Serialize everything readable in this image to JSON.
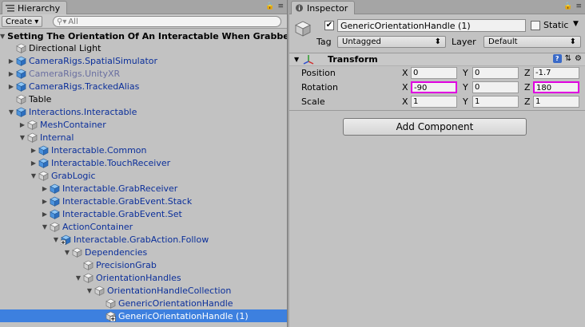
{
  "hierarchy": {
    "tab_label": "Hierarchy",
    "create_label": "Create",
    "search_placeholder": "All",
    "scene_title": "Setting The Orientation Of An Interactable When Grabbed",
    "items": [
      {
        "label": "Directional Light",
        "depth": 1,
        "arrow": "",
        "style": "normal",
        "icon": "cube-gray"
      },
      {
        "label": "CameraRigs.SpatialSimulator",
        "depth": 1,
        "arrow": "collapsed",
        "style": "blue",
        "icon": "prefab-cube"
      },
      {
        "label": "CameraRigs.UnityXR",
        "depth": 1,
        "arrow": "collapsed",
        "style": "dim",
        "icon": "prefab-cube"
      },
      {
        "label": "CameraRigs.TrackedAlias",
        "depth": 1,
        "arrow": "collapsed",
        "style": "blue",
        "icon": "prefab-cube"
      },
      {
        "label": "Table",
        "depth": 1,
        "arrow": "",
        "style": "normal",
        "icon": "cube-gray"
      },
      {
        "label": "Interactions.Interactable",
        "depth": 1,
        "arrow": "expanded",
        "style": "blue",
        "icon": "prefab-cube"
      },
      {
        "label": "MeshContainer",
        "depth": 2,
        "arrow": "collapsed",
        "style": "blue",
        "icon": "cube-gray"
      },
      {
        "label": "Internal",
        "depth": 2,
        "arrow": "expanded",
        "style": "blue",
        "icon": "cube-gray"
      },
      {
        "label": "Interactable.Common",
        "depth": 3,
        "arrow": "collapsed",
        "style": "blue",
        "icon": "prefab-cube"
      },
      {
        "label": "Interactable.TouchReceiver",
        "depth": 3,
        "arrow": "collapsed",
        "style": "blue",
        "icon": "prefab-cube"
      },
      {
        "label": "GrabLogic",
        "depth": 3,
        "arrow": "expanded",
        "style": "blue",
        "icon": "cube-gray"
      },
      {
        "label": "Interactable.GrabReceiver",
        "depth": 4,
        "arrow": "collapsed",
        "style": "blue",
        "icon": "prefab-cube"
      },
      {
        "label": "Interactable.GrabEvent.Stack",
        "depth": 4,
        "arrow": "collapsed",
        "style": "blue",
        "icon": "prefab-cube"
      },
      {
        "label": "Interactable.GrabEvent.Set",
        "depth": 4,
        "arrow": "collapsed",
        "style": "blue",
        "icon": "prefab-cube"
      },
      {
        "label": "ActionContainer",
        "depth": 4,
        "arrow": "expanded",
        "style": "blue",
        "icon": "cube-gray"
      },
      {
        "label": "Interactable.GrabAction.Follow",
        "depth": 5,
        "arrow": "expanded",
        "style": "blue",
        "icon": "prefab-add-cube"
      },
      {
        "label": "Dependencies",
        "depth": 6,
        "arrow": "expanded",
        "style": "blue",
        "icon": "cube-gray"
      },
      {
        "label": "PrecisionGrab",
        "depth": 7,
        "arrow": "",
        "style": "blue",
        "icon": "cube-gray"
      },
      {
        "label": "OrientationHandles",
        "depth": 7,
        "arrow": "expanded",
        "style": "blue",
        "icon": "cube-gray"
      },
      {
        "label": "OrientationHandleCollection",
        "depth": 8,
        "arrow": "expanded",
        "style": "blue",
        "icon": "cube-gray"
      },
      {
        "label": "GenericOrientationHandle",
        "depth": 9,
        "arrow": "",
        "style": "blue",
        "icon": "cube-gray"
      },
      {
        "label": "GenericOrientationHandle (1)",
        "depth": 9,
        "arrow": "",
        "style": "selected",
        "icon": "cube-add-gray"
      }
    ]
  },
  "inspector": {
    "tab_label": "Inspector",
    "object_name": "GenericOrientationHandle (1)",
    "active": true,
    "static_label": "Static",
    "tag_label": "Tag",
    "tag_value": "Untagged",
    "layer_label": "Layer",
    "layer_value": "Default",
    "transform": {
      "title": "Transform",
      "position": {
        "label": "Position",
        "x": "0",
        "y": "0",
        "z": "-1.7"
      },
      "rotation": {
        "label": "Rotation",
        "x": "-90",
        "y": "0",
        "z": "180"
      },
      "scale": {
        "label": "Scale",
        "x": "1",
        "y": "1",
        "z": "1"
      },
      "axis_x": "X",
      "axis_y": "Y",
      "axis_z": "Z"
    },
    "add_component_label": "Add Component"
  },
  "colors": {
    "selection": "#3d80df",
    "highlight": "#e000e0",
    "prefab_blue": "#0b2f9a"
  }
}
